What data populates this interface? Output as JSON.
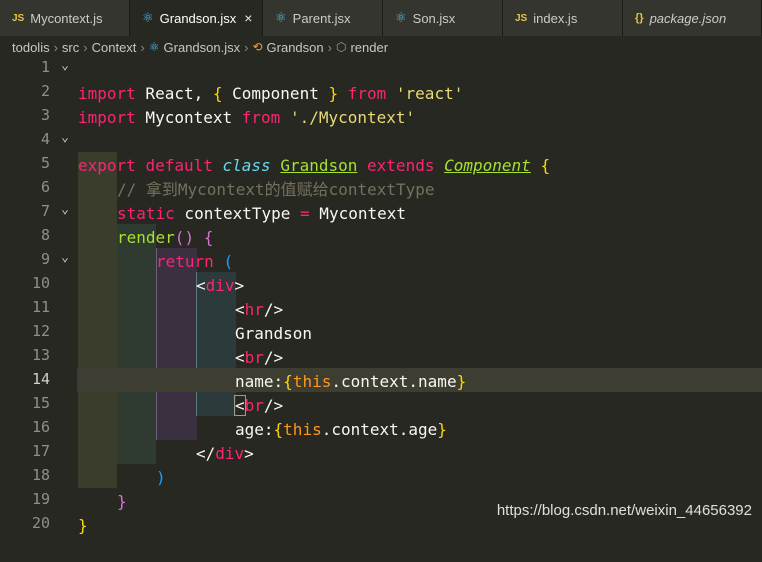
{
  "tabs": [
    {
      "icon": "JS",
      "label": "Mycontext.js",
      "active": false,
      "width": 130
    },
    {
      "icon": "react",
      "label": "Grandson.jsx",
      "active": true,
      "close": "×",
      "width": 133
    },
    {
      "icon": "react",
      "label": "Parent.jsx",
      "active": false,
      "width": 120
    },
    {
      "icon": "react",
      "label": "Son.jsx",
      "active": false,
      "width": 120
    },
    {
      "icon": "JS",
      "label": "index.js",
      "active": false,
      "width": 120
    },
    {
      "icon": "{}",
      "label": "package.json",
      "active": false,
      "italic": true,
      "width": 139
    }
  ],
  "breadcrumb": [
    "todolis",
    "src",
    "Context",
    "Grandson.jsx",
    "Grandson",
    "render"
  ],
  "line_numbers": [
    "1",
    "2",
    "3",
    "4",
    "5",
    "6",
    "7",
    "8",
    "9",
    "10",
    "11",
    "12",
    "13",
    "14",
    "15",
    "16",
    "17",
    "18",
    "19",
    "20"
  ],
  "current_line": "14",
  "code": {
    "l1": [
      "import",
      " React, ",
      "{",
      " Component ",
      "}",
      " from ",
      "'react'"
    ],
    "l2": [
      "import",
      " Mycontext ",
      "from",
      " ",
      "'./Mycontext'"
    ],
    "l4": [
      "export",
      " ",
      "default",
      " ",
      "class",
      " ",
      "Grandson",
      " ",
      "extends",
      " ",
      "Component",
      " ",
      "{"
    ],
    "l5": "// 拿到Mycontext的值赋给contextType",
    "l6": [
      "static",
      " contextType ",
      "=",
      " Mycontext"
    ],
    "l7": [
      "render",
      "(",
      ")",
      " ",
      "{"
    ],
    "l8": [
      "return",
      " ",
      "("
    ],
    "l9": [
      "<",
      "div",
      ">"
    ],
    "l10": [
      "<",
      "hr",
      "/>"
    ],
    "l11": "Grandson",
    "l12": [
      "<",
      "br",
      "/>"
    ],
    "l13": [
      "name:",
      "{",
      "this",
      ".context.name",
      "}"
    ],
    "l14": [
      "<",
      "br",
      "/>"
    ],
    "l15": [
      "age:",
      "{",
      "this",
      ".context.age",
      "}"
    ],
    "l16": [
      "</",
      "div",
      ">"
    ],
    "l17": ")",
    "l18": "}",
    "l19": "}"
  },
  "watermark": "https://blog.csdn.net/weixin_44656392"
}
